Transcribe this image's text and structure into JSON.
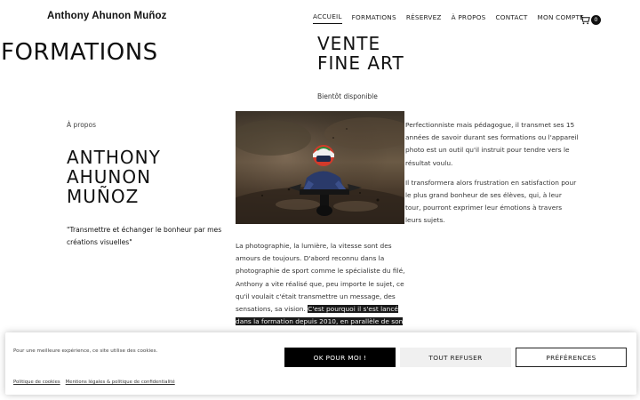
{
  "header": {
    "site_title": "Anthony Ahunon Muñoz",
    "nav": [
      {
        "label": "ACCUEIL",
        "active": true
      },
      {
        "label": "FORMATIONS",
        "active": false
      },
      {
        "label": "RÉSERVEZ",
        "active": false
      },
      {
        "label": "À PROPOS",
        "active": false
      },
      {
        "label": "CONTACT",
        "active": false
      },
      {
        "label": "MON COMPTE",
        "active": false
      }
    ],
    "cart_count": "0",
    "cart_icon": "cart-icon"
  },
  "headings": {
    "formations": "FORMATIONS",
    "vente_line1": "VENTE",
    "vente_line2": "FINE ART",
    "bientot": "Bientôt disponible"
  },
  "about": {
    "label": "À propos",
    "name_line1": "ANTHONY",
    "name_line2": "AHUNON",
    "name_line3": "MUÑOZ",
    "quote": "\"Transmettre et échanger le bonheur par mes créations visuelles\"",
    "mid_text_plain": "La photographie, la lumière, la vitesse sont des amours de toujours. D'abord reconnu dans la photographie de sport comme le spécialiste du filé, Anthony a vite réalisé que, peu importe le sujet, ce qu'il voulait c'était transmettre un message, des sensations, sa vision.",
    "mid_text_highlight": "C'est pourquoi il s'est lancé dans la formation depuis 2010, en parallèle de son",
    "right_p1": "Perfectionniste mais pédagogue, il transmet ses 15 années de savoir durant ses formations ou l'appareil photo est un outil qu'il instruit pour tendre vers le résultat voulu.",
    "right_p2": "Il transformera alors frustration en satisfaction pour le plus grand bonheur de ses élèves, qui, à leur tour, pourront exprimer leur émotions à travers leurs sujets."
  },
  "cookie": {
    "text": "Pour une meilleure expérience, ce site utilise des cookies.",
    "link_cookies": "Politique de cookies",
    "link_legal": "Mentions légales & politique de confidentialité",
    "ok_label": "OK POUR MOI !",
    "refuse_label": "TOUT REFUSER",
    "prefs_label": "PRÉFÉRENCES"
  },
  "colors": {
    "text": "#111111",
    "accent": "#000000",
    "highlight_bg": "#1a1a1a"
  }
}
